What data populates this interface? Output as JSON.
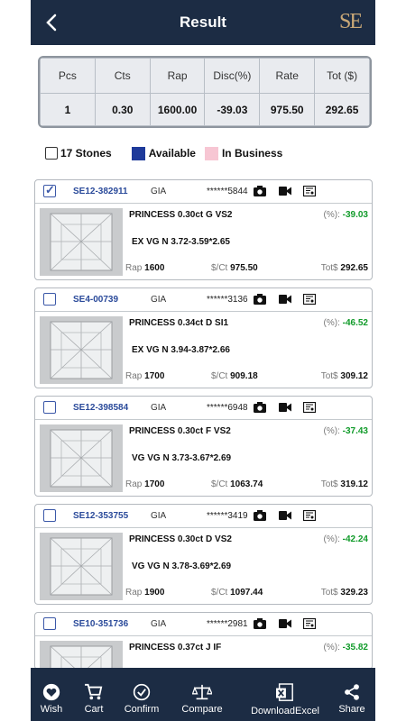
{
  "header": {
    "title": "Result",
    "back_icon": "chevron-left-icon",
    "logo": "SE"
  },
  "summary": {
    "headers": [
      "Pcs",
      "Cts",
      "Rap",
      "Disc(%)",
      "Rate",
      "Tot ($)"
    ],
    "values": [
      "1",
      "0.30",
      "1600.00",
      "-39.03",
      "975.50",
      "292.65"
    ]
  },
  "legend": {
    "stones": "17 Stones",
    "available": "Available",
    "in_business": "In Business",
    "available_color": "#1e3a9a",
    "in_business_color": "#f7c6d3"
  },
  "cards": [
    {
      "id": "SE12-382911",
      "lab": "GIA",
      "cert": "******5844",
      "checked": true,
      "shape_line": "PRINCESS 0.30ct G VS2",
      "pct_label": "(%):",
      "disc": "-39.03",
      "cut_line": "EX VG N 3.72-3.59*2.65",
      "rap_label": "Rap",
      "rap": "1600",
      "ct_label": "$/Ct",
      "per_ct": "975.50",
      "tot_label": "Tot$",
      "tot": "292.65"
    },
    {
      "id": "SE4-00739",
      "lab": "GIA",
      "cert": "******3136",
      "checked": false,
      "shape_line": "PRINCESS 0.34ct D SI1",
      "pct_label": "(%):",
      "disc": "-46.52",
      "cut_line": "EX VG N 3.94-3.87*2.66",
      "rap_label": "Rap",
      "rap": "1700",
      "ct_label": "$/Ct",
      "per_ct": "909.18",
      "tot_label": "Tot$",
      "tot": "309.12"
    },
    {
      "id": "SE12-398584",
      "lab": "GIA",
      "cert": "******6948",
      "checked": false,
      "shape_line": "PRINCESS 0.30ct F VS2",
      "pct_label": "(%):",
      "disc": "-37.43",
      "cut_line": "VG VG N 3.73-3.67*2.69",
      "rap_label": "Rap",
      "rap": "1700",
      "ct_label": "$/Ct",
      "per_ct": "1063.74",
      "tot_label": "Tot$",
      "tot": "319.12"
    },
    {
      "id": "SE12-353755",
      "lab": "GIA",
      "cert": "******3419",
      "checked": false,
      "shape_line": "PRINCESS 0.30ct D VS2",
      "pct_label": "(%):",
      "disc": "-42.24",
      "cut_line": "VG VG N 3.78-3.69*2.69",
      "rap_label": "Rap",
      "rap": "1900",
      "ct_label": "$/Ct",
      "per_ct": "1097.44",
      "tot_label": "Tot$",
      "tot": "329.23"
    },
    {
      "id": "SE10-351736",
      "lab": "GIA",
      "cert": "******2981",
      "checked": false,
      "shape_line": "PRINCESS 0.37ct J IF",
      "pct_label": "(%):",
      "disc": "-35.82"
    }
  ],
  "card_icons": [
    "camera-icon",
    "video-icon",
    "certificate-icon"
  ],
  "bottom_nav": [
    {
      "label": "Wish",
      "icon": "heart-icon"
    },
    {
      "label": "Cart",
      "icon": "cart-icon"
    },
    {
      "label": "Confirm",
      "icon": "confirm-icon"
    },
    {
      "label": "Compare",
      "icon": "scale-icon"
    },
    {
      "label": "DownloadExcel",
      "icon": "excel-icon"
    },
    {
      "label": "Share",
      "icon": "share-icon"
    }
  ]
}
